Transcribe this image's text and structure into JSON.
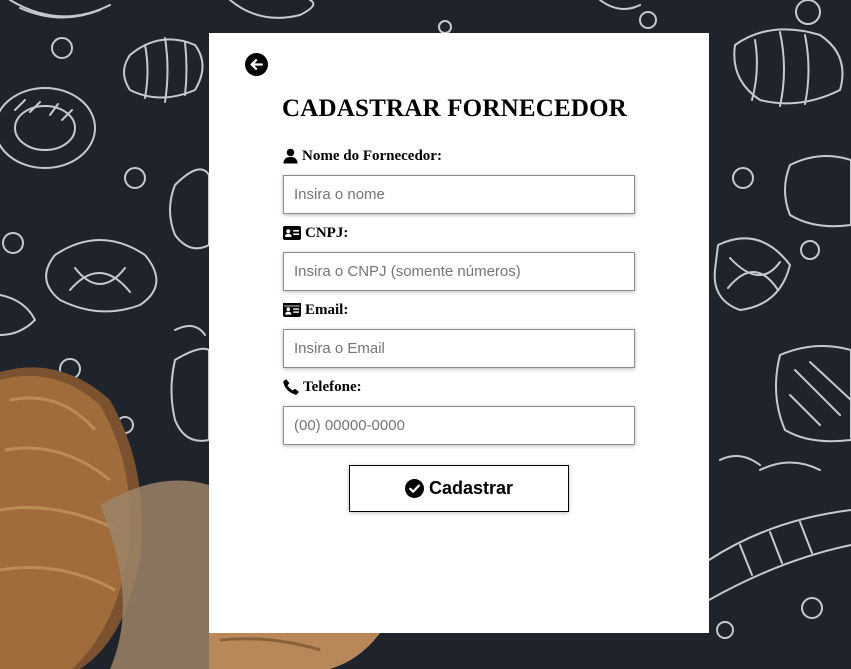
{
  "page": {
    "title": "CADASTRAR FORNECEDOR"
  },
  "form": {
    "fields": [
      {
        "label": "Nome do Fornecedor:",
        "icon": "user-icon",
        "placeholder": "Insira o nome",
        "value": ""
      },
      {
        "label": "CNPJ:",
        "icon": "id-card-icon",
        "placeholder": "Insira o CNPJ (somente números)",
        "value": ""
      },
      {
        "label": "Email:",
        "icon": "id-card-icon",
        "placeholder": "Insira o Email",
        "value": ""
      },
      {
        "label": "Telefone:",
        "icon": "phone-icon",
        "placeholder": "(00) 00000-0000",
        "value": ""
      }
    ],
    "submit_label": "Cadastrar",
    "submit_icon": "check-circle-icon"
  },
  "nav": {
    "back_icon": "arrow-left-circle-icon"
  },
  "colors": {
    "background": "#1f232b",
    "panel": "#ffffff",
    "text": "#000000",
    "input_border": "#8c8c8c",
    "placeholder": "#757575"
  }
}
